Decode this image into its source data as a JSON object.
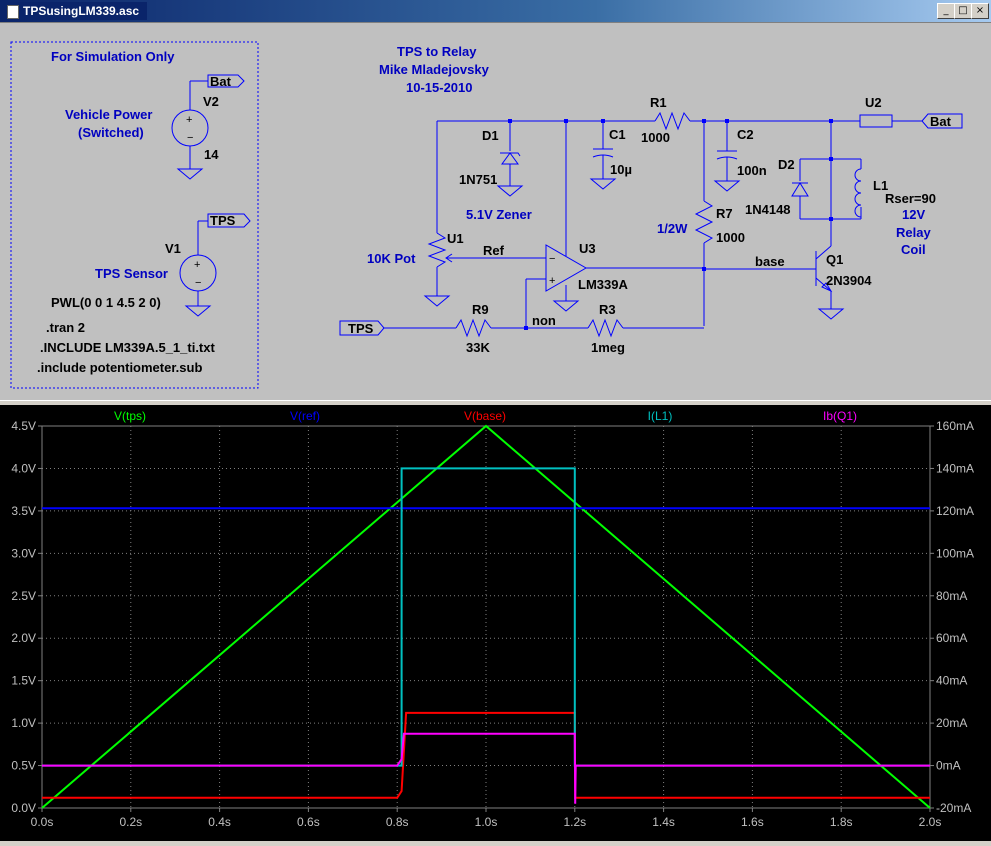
{
  "window": {
    "title": "TPSusingLM339.asc",
    "min_glyph": "_",
    "max_glyph": "□",
    "close_glyph": "×"
  },
  "schematic": {
    "sim_box": {
      "heading": "For Simulation Only",
      "v2": {
        "ref": "V2",
        "label1": "Vehicle Power",
        "label2": "(Switched)",
        "value": "14",
        "net": "Bat"
      },
      "v1": {
        "ref": "V1",
        "label": "TPS Sensor",
        "pwl": "PWL(0 0 1 4.5 2 0)",
        "net": "TPS"
      },
      "directives": [
        ".tran 2",
        ".INCLUDE LM339A.5_1_ti.txt",
        ".include potentiometer.sub"
      ]
    },
    "header": {
      "line1": "TPS to Relay",
      "line2": "Mike Mladejovsky",
      "line3": "10-15-2010"
    },
    "components": {
      "d1": {
        "ref": "D1",
        "value": "1N751",
        "note": "5.1V Zener"
      },
      "c1": {
        "ref": "C1",
        "value": "10µ"
      },
      "r1": {
        "ref": "R1",
        "value": "1000"
      },
      "c2": {
        "ref": "C2",
        "value": "100n"
      },
      "u2": {
        "ref": "U2"
      },
      "bat_label": "Bat",
      "d2": {
        "ref": "D2",
        "value": "1N4148"
      },
      "l1": {
        "ref": "L1",
        "rser": "Rser=90",
        "note1": "12V",
        "note2": "Relay",
        "note3": "Coil"
      },
      "r7": {
        "ref": "R7",
        "value": "1000",
        "note": "1/2W"
      },
      "u1": {
        "ref": "U1",
        "note": "10K Pot"
      },
      "ref_net": "Ref",
      "u3": {
        "ref": "U3",
        "value": "LM339A"
      },
      "base_net": "base",
      "q1": {
        "ref": "Q1",
        "value": "2N3904"
      },
      "tps_label": "TPS",
      "r9": {
        "ref": "R9",
        "value": "33K"
      },
      "non_net": "non",
      "r3": {
        "ref": "R3",
        "value": "1meg"
      }
    }
  },
  "chart_data": {
    "type": "line",
    "x_ticks": [
      "0.0s",
      "0.2s",
      "0.4s",
      "0.6s",
      "0.8s",
      "1.0s",
      "1.2s",
      "1.4s",
      "1.6s",
      "1.8s",
      "2.0s"
    ],
    "y_left_ticks": [
      "0.0V",
      "0.5V",
      "1.0V",
      "1.5V",
      "2.0V",
      "2.5V",
      "3.0V",
      "3.5V",
      "4.0V",
      "4.5V"
    ],
    "y_right_ticks": [
      "-20mA",
      "0mA",
      "20mA",
      "40mA",
      "60mA",
      "80mA",
      "100mA",
      "120mA",
      "140mA",
      "160mA"
    ],
    "xlim": [
      0,
      2
    ],
    "ylim_left": [
      0,
      4.5
    ],
    "ylim_right": [
      -20,
      160
    ],
    "grid": true,
    "series": [
      {
        "name": "V(tps)",
        "color": "#00ff00",
        "axis": "left",
        "x": [
          0,
          1,
          2
        ],
        "y": [
          0,
          4.5,
          0
        ]
      },
      {
        "name": "V(ref)",
        "color": "#0000ff",
        "axis": "left",
        "x": [
          0,
          2
        ],
        "y": [
          3.53,
          3.53
        ]
      },
      {
        "name": "V(base)",
        "color": "#ff0000",
        "axis": "left",
        "x": [
          0,
          0.8,
          0.81,
          0.82,
          1.2,
          1.201,
          2
        ],
        "y": [
          0.12,
          0.12,
          0.2,
          1.12,
          1.12,
          0.12,
          0.12
        ]
      },
      {
        "name": "I(L1)",
        "color": "#00c0c0",
        "axis": "right",
        "x": [
          0,
          0.8,
          0.81,
          0.81,
          1.2,
          1.2,
          2
        ],
        "y": [
          0,
          0,
          0,
          140,
          140,
          0,
          0
        ]
      },
      {
        "name": "Ib(Q1)",
        "color": "#ff00ff",
        "axis": "right",
        "x": [
          0,
          0.8,
          0.81,
          0.815,
          1.2,
          1.201,
          1.202,
          2
        ],
        "y": [
          0,
          0,
          3,
          15,
          15,
          -18,
          0,
          0
        ]
      }
    ]
  }
}
